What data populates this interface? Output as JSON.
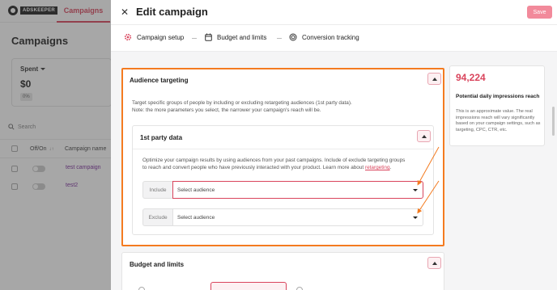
{
  "background_app": {
    "logo_text": "ADSKEEPER",
    "tab_label": "Campaigns",
    "page_title": "Campaigns",
    "spent_label": "Spent",
    "spent_value": "$0",
    "spent_pct": "0%",
    "search_placeholder": "Search",
    "table_headers": [
      "Off/On",
      "Campaign name"
    ],
    "rows": [
      {
        "name": "test campaign"
      },
      {
        "name": "test2"
      }
    ]
  },
  "modal": {
    "title": "Edit campaign",
    "save_label": "Save",
    "close_icon": "✕",
    "steps": [
      {
        "label": "Campaign setup",
        "icon": "gear-icon"
      },
      {
        "label": "Budget and limits",
        "icon": "calendar-icon"
      },
      {
        "label": "Conversion tracking",
        "icon": "target-icon"
      }
    ]
  },
  "audience_targeting": {
    "title": "Audience targeting",
    "description_line1": "Target specific groups of people by including or excluding retargeting audiences (1st party data).",
    "description_line2": "Note: the more parameters you select, the narrower your campaign's reach will be.",
    "first_party": {
      "title": "1st party data",
      "description_line1": "Optimize your campaign results by using audiences from your past campaigns. Include of exclude targeting groups",
      "description_line2_prefix": "to reach and convert people who have previously interacted with your product. Learn more about ",
      "description_link": "retargeting",
      "description_line2_suffix": ".",
      "include_label": "Include",
      "include_placeholder": "Select audience",
      "exclude_label": "Exclude",
      "exclude_placeholder": "Select audience"
    }
  },
  "budget_limits": {
    "title": "Budget and limits"
  },
  "impressions": {
    "value": "94,224",
    "title": "Potential daily impressions reach",
    "description": "This is an approximate value. The real impressions reach will vary significantly based on your campaign settings, such as targeting, CPC, CTR, etc."
  },
  "colors": {
    "accent": "#d9445c",
    "highlight": "#f47b20",
    "save_button": "#f28a9b"
  }
}
